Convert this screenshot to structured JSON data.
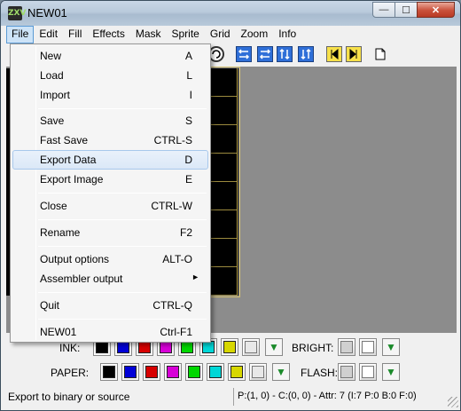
{
  "window": {
    "title": "NEW01",
    "icon_label": "ZXV"
  },
  "menubar": {
    "items": [
      "File",
      "Edit",
      "Fill",
      "Effects",
      "Mask",
      "Sprite",
      "Grid",
      "Zoom",
      "Info"
    ],
    "active": "File"
  },
  "file_menu": {
    "items": [
      {
        "label": "New",
        "shortcut": "A"
      },
      {
        "label": "Load",
        "shortcut": "L"
      },
      {
        "label": "Import",
        "shortcut": "I"
      },
      {
        "label": "Save",
        "shortcut": "S"
      },
      {
        "label": "Fast Save",
        "shortcut": "CTRL-S"
      },
      {
        "label": "Export Data",
        "shortcut": "D",
        "highlighted": true
      },
      {
        "label": "Export Image",
        "shortcut": "E"
      },
      {
        "label": "Close",
        "shortcut": "CTRL-W"
      },
      {
        "label": "Rename",
        "shortcut": "F2"
      },
      {
        "label": "Output options",
        "shortcut": "ALT-O"
      },
      {
        "label": "Assembler output",
        "shortcut": "",
        "submenu_arrow": "►"
      },
      {
        "label": "Quit",
        "shortcut": "CTRL-Q"
      },
      {
        "label": "NEW01",
        "shortcut": "Ctrl-F1"
      }
    ]
  },
  "palette": {
    "ink_label": "INK:",
    "paper_label": "PAPER:",
    "bright_label": "BRIGHT:",
    "flash_label": "FLASH:",
    "colors": [
      "#000000",
      "#0000d7",
      "#d70000",
      "#d700d7",
      "#00d700",
      "#00d7d7",
      "#d7d700",
      "#d7d7d7"
    ],
    "accent_selected": "#d7d7d7"
  },
  "status": {
    "hint": "Export to binary or source",
    "info": "P:(1, 0) - C:(0, 0) - Attr: 7 (I:7 P:0 B:0 F:0)"
  },
  "icons": {
    "minimize": "—",
    "maximize": "☐",
    "close": "✕",
    "transparent": "▼"
  }
}
